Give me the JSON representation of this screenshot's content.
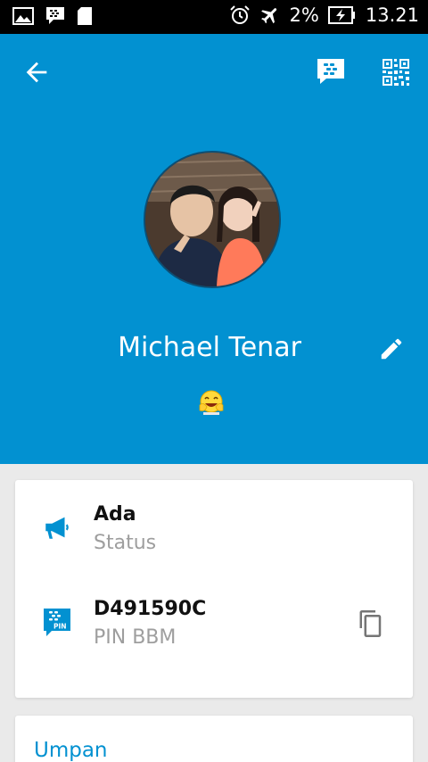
{
  "status_bar": {
    "battery": "2%",
    "time": "13.21",
    "icons": [
      "gallery-icon",
      "bbm-notification-icon",
      "sd-card-icon",
      "alarm-icon",
      "airplane-mode-icon",
      "battery-charging-icon"
    ]
  },
  "toolbar": {
    "back_icon": "arrow-back-icon",
    "bbm_icon": "bbm-chat-icon",
    "qr_icon": "qr-code-icon"
  },
  "profile": {
    "name": "Michael Tenar",
    "emoji": "laughing-emoji",
    "edit_icon": "pencil-icon"
  },
  "details": {
    "status_value": "Ada",
    "status_label": "Status",
    "pin_value": "D491590C",
    "pin_label": "PIN BBM",
    "pin_icon_text": "PIN"
  },
  "feed": {
    "title": "Umpan"
  },
  "colors": {
    "primary": "#0291d1",
    "background": "#eaeaea"
  }
}
